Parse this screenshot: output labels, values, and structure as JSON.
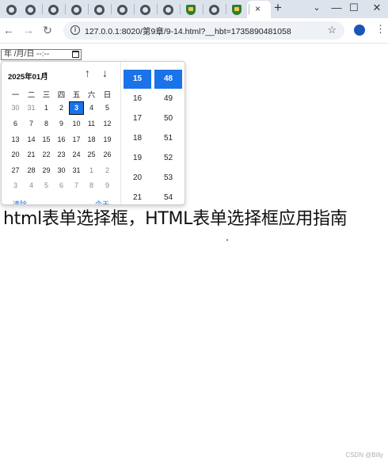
{
  "browser": {
    "tab_close_glyph": "×",
    "new_tab_glyph": "+",
    "window_controls": {
      "dropdown": "⌄",
      "minimize": "—",
      "maximize": "☐",
      "close": "✕"
    },
    "nav": {
      "back": "←",
      "forward": "→",
      "reload": "↻"
    },
    "url": "127.0.0.1:8020/第9章/9-14.html?__hbt=1735890481058",
    "bookmark_glyph": "☆",
    "menu_glyph": "⋮",
    "tab_icons": [
      "globe-icon",
      "globe-icon",
      "globe-icon",
      "globe-icon",
      "globe-icon",
      "globe-icon",
      "globe-icon",
      "shield-icon",
      "globe-icon",
      "shield-icon"
    ]
  },
  "date_input": {
    "placeholder": "年 /月/日 --:--"
  },
  "picker": {
    "month_label": "2025年01月",
    "caret": "▾",
    "up_arrow": "↑",
    "down_arrow": "↓",
    "weekdays": [
      "一",
      "二",
      "三",
      "四",
      "五",
      "六",
      "日"
    ],
    "weeks": [
      [
        {
          "d": "30",
          "o": true
        },
        {
          "d": "31",
          "o": true
        },
        {
          "d": "1"
        },
        {
          "d": "2"
        },
        {
          "d": "3",
          "sel": true
        },
        {
          "d": "4"
        },
        {
          "d": "5"
        }
      ],
      [
        {
          "d": "6"
        },
        {
          "d": "7"
        },
        {
          "d": "8"
        },
        {
          "d": "9"
        },
        {
          "d": "10"
        },
        {
          "d": "11"
        },
        {
          "d": "12"
        }
      ],
      [
        {
          "d": "13"
        },
        {
          "d": "14"
        },
        {
          "d": "15"
        },
        {
          "d": "16"
        },
        {
          "d": "17"
        },
        {
          "d": "18"
        },
        {
          "d": "19"
        }
      ],
      [
        {
          "d": "20"
        },
        {
          "d": "21"
        },
        {
          "d": "22"
        },
        {
          "d": "23"
        },
        {
          "d": "24"
        },
        {
          "d": "25"
        },
        {
          "d": "26"
        }
      ],
      [
        {
          "d": "27"
        },
        {
          "d": "28"
        },
        {
          "d": "29"
        },
        {
          "d": "30"
        },
        {
          "d": "31"
        },
        {
          "d": "1",
          "o": true
        },
        {
          "d": "2",
          "o": true
        }
      ],
      [
        {
          "d": "3",
          "o": true
        },
        {
          "d": "4",
          "o": true
        },
        {
          "d": "5",
          "o": true
        },
        {
          "d": "6",
          "o": true
        },
        {
          "d": "7",
          "o": true
        },
        {
          "d": "8",
          "o": true
        },
        {
          "d": "9",
          "o": true
        }
      ]
    ],
    "clear_label": "清除",
    "today_label": "今天",
    "hours": [
      "15",
      "16",
      "17",
      "18",
      "19",
      "20",
      "21"
    ],
    "minutes": [
      "48",
      "49",
      "50",
      "51",
      "52",
      "53",
      "54"
    ],
    "selected_hour": "15",
    "selected_minute": "48",
    "accent_color": "#1a73e8"
  },
  "caption": "html表单选择框，HTML表单选择框应用指南",
  "watermark": "CSDN @Billy"
}
